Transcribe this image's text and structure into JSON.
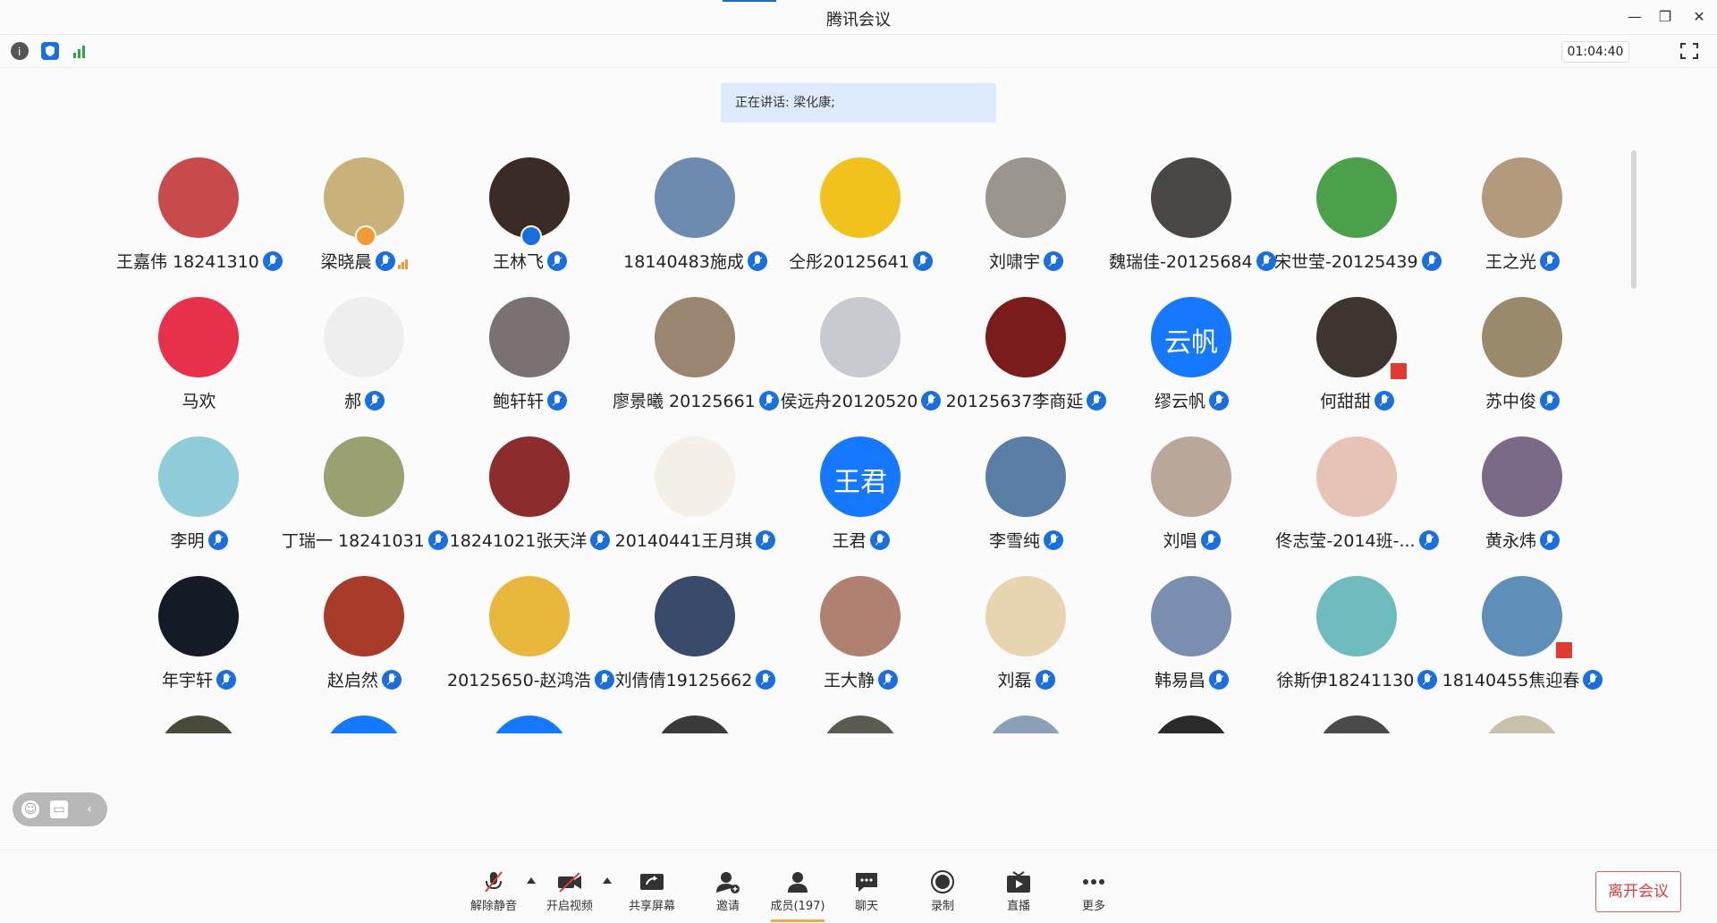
{
  "window": {
    "title": "腾讯会议",
    "controls": {
      "minimize": "—",
      "restore": "❐",
      "close": "✕"
    }
  },
  "toolbar": {
    "icons": [
      "info-icon",
      "shield-icon",
      "signal-icon"
    ],
    "timer": "01:04:40"
  },
  "speaking": "正在讲话: 梁化康;",
  "participants": [
    {
      "name": "王嘉伟 18241310",
      "bg": "#c94a4a",
      "mic": true
    },
    {
      "name": "梁晓晨",
      "bg": "#c8b27a",
      "mic": true,
      "signal": true,
      "badge": "orange"
    },
    {
      "name": "王林飞",
      "bg": "#3a2b24",
      "mic": true,
      "badge": "blue"
    },
    {
      "name": "18140483施成",
      "bg": "#6d8bb0",
      "mic": true
    },
    {
      "name": "仝彤20125641",
      "bg": "#f2c21c",
      "mic": true
    },
    {
      "name": "刘啸宇",
      "bg": "#9a958d",
      "mic": true
    },
    {
      "name": "魏瑞佳-20125684",
      "bg": "#4a4744",
      "mic": true
    },
    {
      "name": "宋世莹-20125439",
      "bg": "#4ba04a",
      "mic": true
    },
    {
      "name": "王之光",
      "bg": "#b49a7c",
      "mic": true
    },
    {
      "name": "马欢",
      "bg": "#e8304a",
      "mic": false
    },
    {
      "name": "郝",
      "bg": "#eeeeee",
      "mic": true
    },
    {
      "name": "鲍轩轩",
      "bg": "#7a7272",
      "mic": true
    },
    {
      "name": "廖景曦 20125661",
      "bg": "#9a8670",
      "mic": true
    },
    {
      "name": "侯远舟20120520",
      "bg": "#c7cbcf",
      "mic": true
    },
    {
      "name": "20125637李商延",
      "bg": "#7a1c1c",
      "mic": true
    },
    {
      "name": "缪云帆",
      "bg": "#1677ff",
      "text": "云帆",
      "mic": true
    },
    {
      "name": "何甜甜",
      "bg": "#3e3530",
      "mic": true,
      "flag": true
    },
    {
      "name": "苏中俊",
      "bg": "#9a8a6c",
      "mic": true
    },
    {
      "name": "李明",
      "bg": "#8fcbd8",
      "mic": true
    },
    {
      "name": "丁瑞一 18241031",
      "bg": "#9aa070",
      "mic": true
    },
    {
      "name": "18241021张天洋",
      "bg": "#8c2c2c",
      "mic": true
    },
    {
      "name": "20140441王月琪",
      "bg": "#f4f0e8",
      "mic": true
    },
    {
      "name": "王君",
      "bg": "#1677ff",
      "text": "王君",
      "mic": true
    },
    {
      "name": "李雪纯",
      "bg": "#5b7ea6",
      "mic": true
    },
    {
      "name": "刘唱",
      "bg": "#b9a89a",
      "mic": true
    },
    {
      "name": "佟志莹-2014班-...",
      "bg": "#e6c3b4",
      "mic": true
    },
    {
      "name": "黄永炜",
      "bg": "#7a6a88",
      "mic": true
    },
    {
      "name": "年宇轩",
      "bg": "#141b26",
      "mic": true
    },
    {
      "name": "赵启然",
      "bg": "#a83a2a",
      "mic": true
    },
    {
      "name": "20125650-赵鸿浩",
      "bg": "#e9b73c",
      "mic": true
    },
    {
      "name": "刘倩倩19125662",
      "bg": "#3a4a6a",
      "mic": true
    },
    {
      "name": "王大静",
      "bg": "#b08070",
      "mic": true
    },
    {
      "name": "刘磊",
      "bg": "#e8d4b0",
      "mic": true
    },
    {
      "name": "韩易昌",
      "bg": "#7a8fb0",
      "mic": true
    },
    {
      "name": "徐斯伊18241130",
      "bg": "#6fbcbf",
      "mic": true
    },
    {
      "name": "18140455焦迎春",
      "bg": "#5d8fb8",
      "mic": true,
      "flag": true
    },
    {
      "name": "",
      "bg": "#4a4a3a",
      "mic": false
    },
    {
      "name": "",
      "bg": "#1677ff",
      "mic": false
    },
    {
      "name": "",
      "bg": "#1677ff",
      "mic": false
    },
    {
      "name": "",
      "bg": "#3a3a3a",
      "mic": false
    },
    {
      "name": "",
      "bg": "#5a5a50",
      "mic": false
    },
    {
      "name": "",
      "bg": "#8aa0b8",
      "mic": false
    },
    {
      "name": "",
      "bg": "#2a2a2a",
      "mic": false
    },
    {
      "name": "",
      "bg": "#4a4a4a",
      "mic": false
    },
    {
      "name": "",
      "bg": "#c8c0a8",
      "mic": false
    }
  ],
  "bottom": {
    "unmute": "解除静音",
    "video": "开启视频",
    "share": "共享屏幕",
    "invite": "邀请",
    "members": "成员(197)",
    "chat": "聊天",
    "record": "录制",
    "live": "直播",
    "more": "更多",
    "leave": "离开会议"
  },
  "colors": {
    "accent": "#1a6fe0",
    "leave": "#e03b3b",
    "speaking_bg": "#dceafb"
  }
}
